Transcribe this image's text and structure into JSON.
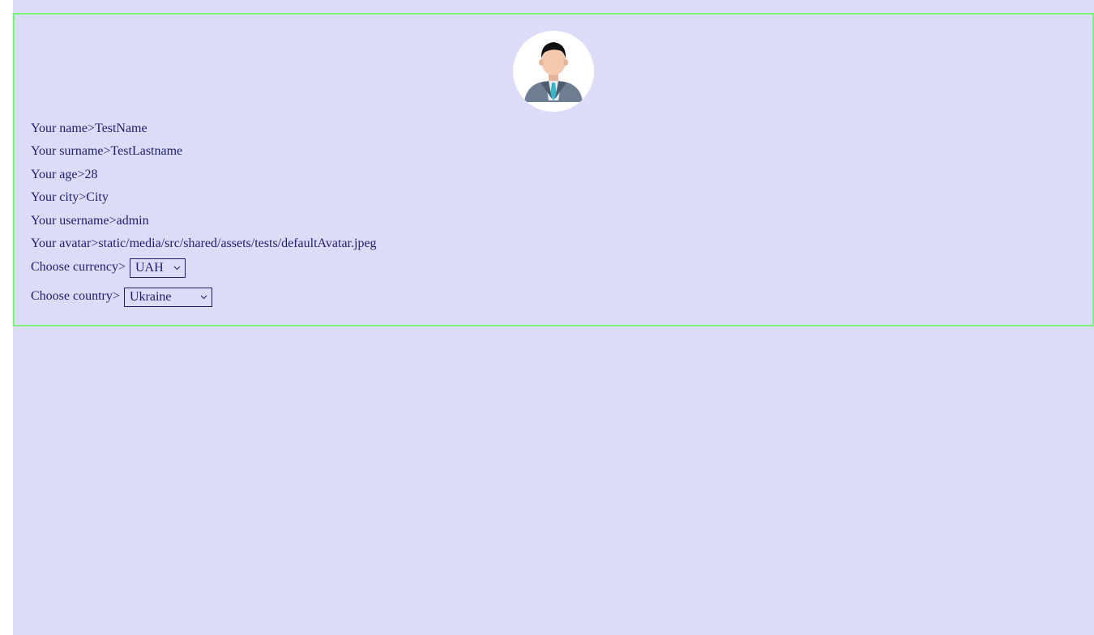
{
  "profile": {
    "name_label": "Your name>",
    "name_value": "TestName",
    "surname_label": "Your surname>",
    "surname_value": "TestLastname",
    "age_label": "Your age>",
    "age_value": "28",
    "city_label": "Your city>",
    "city_value": "City",
    "username_label": "Your username>",
    "username_value": "admin",
    "avatar_label": "Your avatar>",
    "avatar_value": "static/media/src/shared/assets/tests/defaultAvatar.jpeg",
    "currency_label": "Choose currency>",
    "currency_value": "UAH",
    "country_label": "Choose country>",
    "country_value": "Ukraine"
  },
  "icons": {
    "avatar": "user-avatar-icon",
    "dropdown": "chevron-down-icon"
  },
  "colors": {
    "background": "#dcdcf9",
    "border": "#7cf27c",
    "text": "#1d1d6b"
  }
}
